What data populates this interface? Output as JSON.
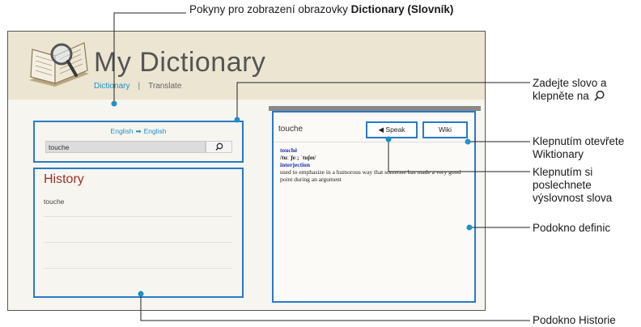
{
  "annotations": {
    "top": "Pokyny pro zobrazení obrazovky",
    "top_bold": "Dictionary (Slovník)",
    "enter_word": [
      "Zadejte slovo a",
      "klepněte na"
    ],
    "wiktionary": [
      "Klepnutím otevřete",
      "Wiktionary"
    ],
    "pronunciation": [
      "Klepnutím si",
      "poslechnete",
      "výslovnost slova"
    ],
    "definition_pane": "Podokno definic",
    "history_pane": "Podokno Historie"
  },
  "app": {
    "title": "My Dictionary",
    "nav": {
      "dictionary": "Dictionary",
      "separator": "|",
      "translate": "Translate"
    }
  },
  "search": {
    "source_lang": "English",
    "target_lang": "English",
    "value": "touche",
    "icon": "search-icon"
  },
  "history": {
    "title": "History",
    "items": [
      "touche"
    ]
  },
  "definition": {
    "word": "touche",
    "speak_label": "Speak",
    "wiki_label": "Wiki",
    "headword": "touché",
    "pronunciation": "/tuːˈʃeː; ˈtuʃeɪ/",
    "part_of_speech": "interjection",
    "meaning": "used to emphasize in a humorous way that someone has made a very good point during an argument"
  },
  "colors": {
    "accent": "#2a79c9",
    "link": "#1e90c8",
    "history_title": "#a03028",
    "header_bg": "#ece5d2"
  }
}
